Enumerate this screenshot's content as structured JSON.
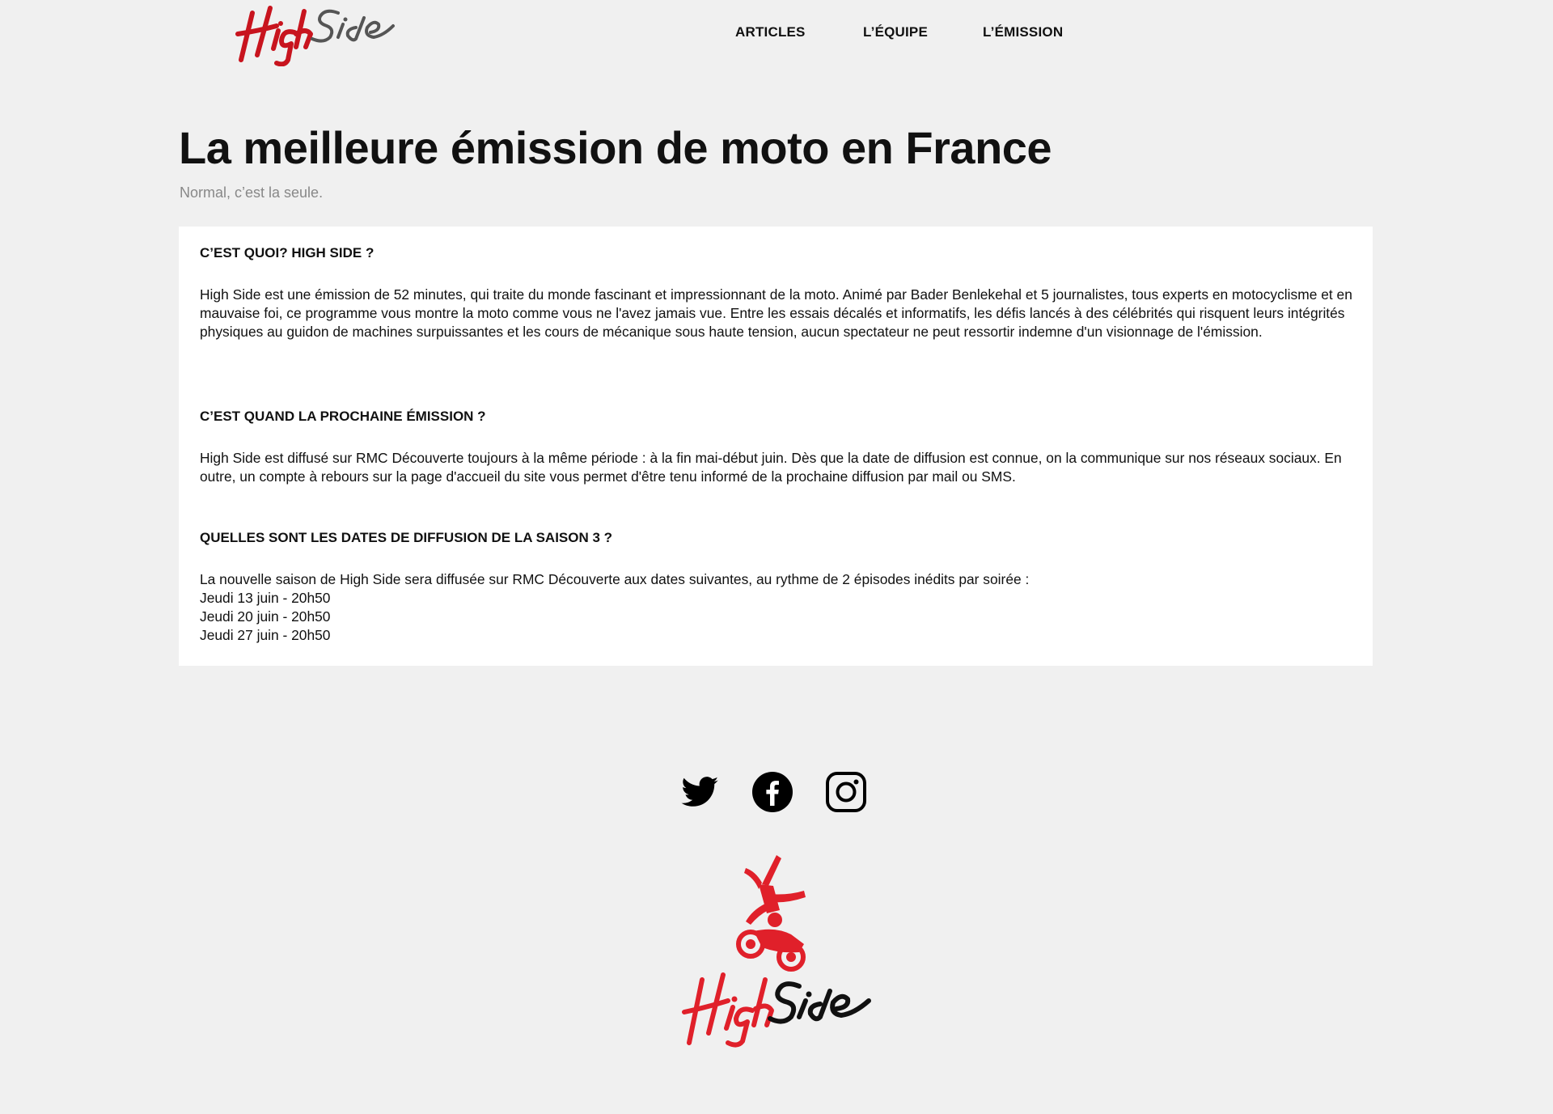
{
  "header": {
    "logo_text": "HighSide",
    "nav": [
      {
        "label": "ARTICLES"
      },
      {
        "label": "L’ÉQUIPE"
      },
      {
        "label": "L’ÉMISSION"
      }
    ]
  },
  "hero": {
    "title": "La meilleure émission de moto en France",
    "subtitle": "Normal, c’est la seule."
  },
  "sections": [
    {
      "heading": "C’EST QUOI? HIGH SIDE ?",
      "body": "High Side est une émission de 52 minutes, qui traite du monde fascinant et impressionnant de la moto. Animé par Bader Benlekehal et 5 journalistes, tous experts en motocyclisme et en mauvaise foi, ce programme vous montre la moto comme vous ne l'avez jamais vue. Entre les essais décalés et informatifs, les défis lancés à des célébrités qui risquent leurs intégrités physiques au guidon de machines surpuissantes et les cours de mécanique sous haute tension, aucun spectateur ne peut ressortir indemne d'un visionnage de l'émission."
    },
    {
      "heading": "C’EST QUAND LA PROCHAINE ÉMISSION ?",
      "body": "High Side est diffusé sur RMC Découverte toujours à la même période : à la fin mai-début juin. Dès que la date de diffusion est connue, on la communique sur nos réseaux sociaux. En outre, un compte à rebours sur la page d'accueil du site vous permet d'être tenu informé de la prochaine diffusion par mail ou SMS."
    },
    {
      "heading": "QUELLES SONT LES DATES DE DIFFUSION DE LA SAISON 3 ?",
      "body": "La nouvelle saison de High Side sera diffusée sur RMC Découverte aux dates suivantes, au rythme de 2 épisodes inédits par soirée :",
      "dates": [
        "Jeudi 13 juin - 20h50",
        "Jeudi 20 juin - 20h50",
        "Jeudi 27 juin - 20h50"
      ]
    }
  ],
  "footer": {
    "socials": [
      {
        "icon": "twitter-icon"
      },
      {
        "icon": "facebook-icon"
      },
      {
        "icon": "instagram-icon"
      }
    ],
    "logo_text": "HighSide"
  },
  "colors": {
    "background": "#f0f0f0",
    "card": "#ffffff",
    "brand_red": "#e0202a",
    "text": "#111111",
    "muted": "#888888"
  }
}
